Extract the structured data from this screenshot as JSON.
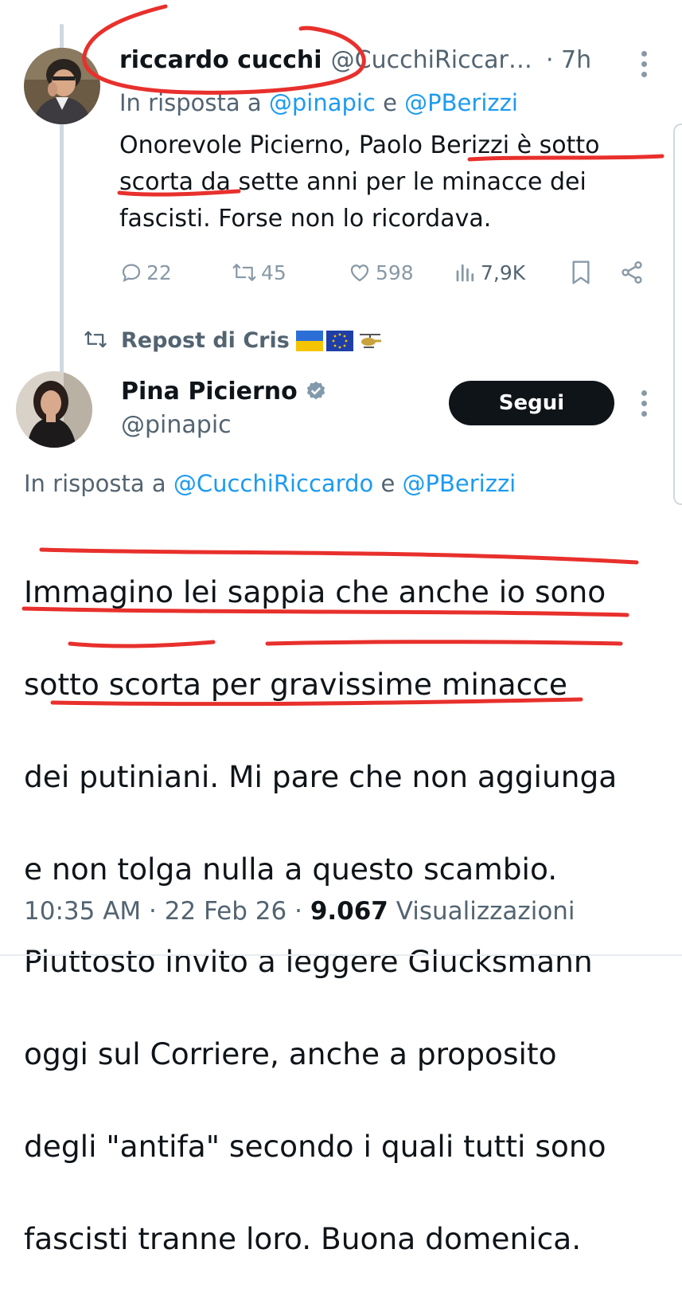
{
  "tweet1": {
    "display_name": "riccardo cucchi",
    "handle": "@CucchiRiccar…",
    "time": "· 7h",
    "reply_prefix": "In risposta a",
    "reply_mention_1": "@pinapic",
    "reply_and": "e",
    "reply_mention_2": "@PBerizzi",
    "text_lines": [
      "Onorevole Picierno, Paolo Berizzi è sotto",
      "scorta da sette anni per le minacce dei",
      "fascisti. Forse non lo ricordava."
    ],
    "stats": {
      "replies": "22",
      "reposts": "45",
      "likes": "598",
      "views": "7,9K"
    }
  },
  "repost_label": "Repost di Cris",
  "repost_emojis": [
    "flag-ukraine",
    "flag-eu",
    "helicopter"
  ],
  "tweet2": {
    "display_name": "Pina Picierno",
    "verified": true,
    "handle": "@pinapic",
    "follow_label": "Segui",
    "reply_prefix": "In risposta a",
    "reply_mention_1": "@CucchiRiccardo",
    "reply_and": "e",
    "reply_mention_2": "@PBerizzi",
    "text_lines": [
      "Immagino lei sappia che anche io sono",
      "sotto scorta per gravissime minacce",
      "dei putiniani. Mi pare che non aggiunga",
      "e non tolga nulla a questo scambio.",
      "Piuttosto invito a leggere Glucksmann",
      "oggi sul Corriere, anche  a proposito",
      "degli \"antifa\" secondo i quali tutti sono",
      "fascisti tranne loro. Buona domenica."
    ],
    "time": "10:35 AM",
    "date": "22 Feb 26",
    "views_count": "9.067",
    "views_label": "Visualizzazioni"
  },
  "colors": {
    "text": "#0f1419",
    "secondary": "#536471",
    "link": "#1d9bf0",
    "annotation_red": "#e8302c",
    "button_bg": "#0f1419"
  },
  "icons": [
    "reply-icon",
    "repost-icon",
    "like-icon",
    "views-icon",
    "bookmark-icon",
    "share-icon",
    "more-icon",
    "verified-badge-icon"
  ]
}
